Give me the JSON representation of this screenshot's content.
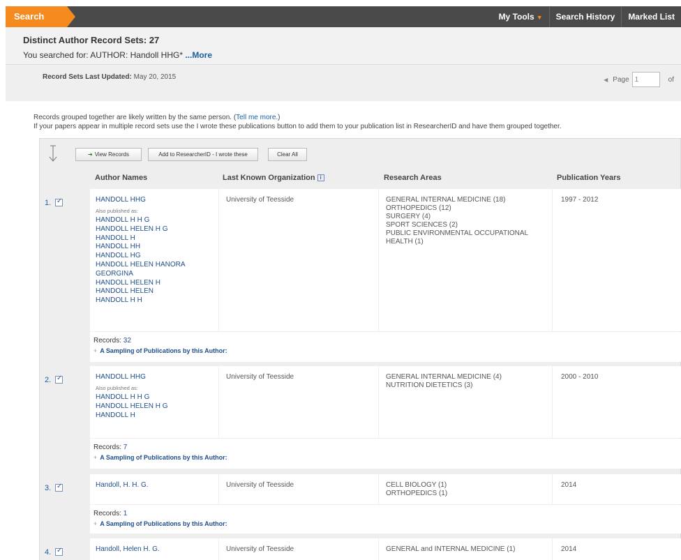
{
  "topbar": {
    "search_tab": "Search",
    "nav": [
      {
        "label": "My Tools",
        "has_caret": true
      },
      {
        "label": "Search History",
        "has_caret": false
      },
      {
        "label": "Marked List",
        "has_caret": false
      }
    ]
  },
  "header": {
    "title": "Distinct Author Record Sets: 27",
    "searched_prefix": "You searched for: AUTHOR: Handoll HHG*",
    "more_link": "...More",
    "updated_label": "Record Sets Last Updated:",
    "updated_value": "May 20, 2015",
    "pager": {
      "label": "Page",
      "value": "1",
      "of_label": "of"
    }
  },
  "notes": {
    "line1_prefix": "Records grouped together are likely written by the same person. (",
    "tell_me_more": "Tell me more.",
    "line1_suffix": ")",
    "line2": "If your papers appear in multiple record sets use the I wrote these publications button to add them to your publication list in ResearcherID and have them grouped together."
  },
  "toolbar": {
    "view_records": "View Records",
    "add_researcherid": "Add to ResearcherID - I wrote these",
    "clear_all": "Clear All"
  },
  "columns": {
    "author_names": "Author Names",
    "last_known_org": "Last Known Organization",
    "research_areas": "Research Areas",
    "publication_years": "Publication Years"
  },
  "records": [
    {
      "num": "1.",
      "primary": "HANDOLL HHG",
      "aka_label": "Also published as:",
      "aliases": [
        "HANDOLL H H G",
        "HANDOLL HELEN H G",
        "HANDOLL H",
        "HANDOLL HH",
        "HANDOLL HG",
        "HANDOLL HELEN HANORA",
        "GEORGINA",
        "HANDOLL HELEN H",
        "HANDOLL HELEN",
        "HANDOLL H H"
      ],
      "organization": "University of Teesside",
      "areas": [
        "GENERAL INTERNAL MEDICINE (18)",
        "ORTHOPEDICS (12)",
        "SURGERY (4)",
        "SPORT SCIENCES (2)",
        "PUBLIC ENVIRONMENTAL OCCUPATIONAL",
        "HEALTH (1)"
      ],
      "years": "1997 - 2012",
      "records_label": "Records:",
      "records_count": "32",
      "sampling": "A Sampling of Publications by this Author:"
    },
    {
      "num": "2.",
      "primary": "HANDOLL HHG",
      "aka_label": "Also published as:",
      "aliases": [
        "HANDOLL H H G",
        "HANDOLL HELEN H G",
        "HANDOLL H"
      ],
      "organization": "University of Teesside",
      "areas": [
        "GENERAL INTERNAL MEDICINE (4)",
        "NUTRITION DIETETICS (3)"
      ],
      "years": "2000 - 2010",
      "records_label": "Records:",
      "records_count": "7",
      "sampling": "A Sampling of Publications by this Author:"
    },
    {
      "num": "3.",
      "primary": "Handoll, H. H. G.",
      "organization": "University of Teesside",
      "areas": [
        "CELL BIOLOGY (1)",
        "ORTHOPEDICS (1)"
      ],
      "years": "2014",
      "records_label": "Records:",
      "records_count": "1",
      "sampling": "A Sampling of Publications by this Author:"
    },
    {
      "num": "4.",
      "primary": "Handoll, Helen H. G.",
      "organization": "University of Teesside",
      "areas": [
        "GENERAL and INTERNAL MEDICINE (1)"
      ],
      "years": "2014"
    }
  ]
}
